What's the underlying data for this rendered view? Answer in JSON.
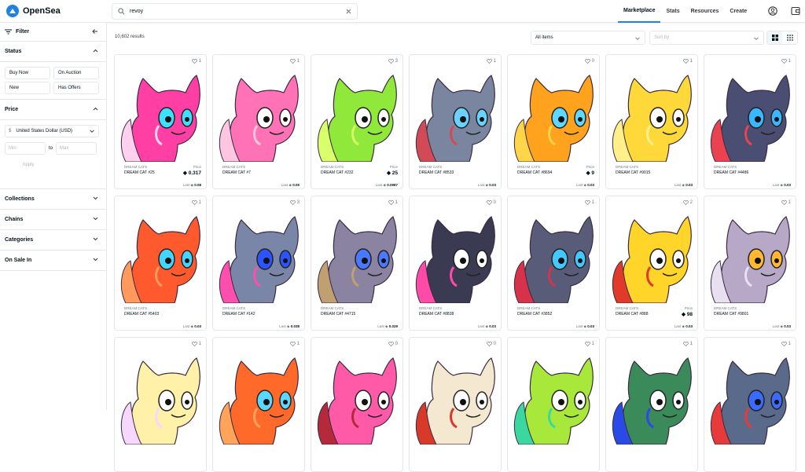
{
  "app": {
    "name": "OpenSea"
  },
  "search": {
    "value": "revoy"
  },
  "nav": {
    "items": [
      "Marketplace",
      "Stats",
      "Resources",
      "Create"
    ],
    "active": "Marketplace"
  },
  "sidebar": {
    "filter_label": "Filter",
    "status": {
      "label": "Status",
      "chips": [
        "Buy Now",
        "On Auction",
        "New",
        "Has Offers"
      ]
    },
    "price": {
      "label": "Price",
      "currency": "United States Dollar (USD)",
      "currency_symbol": "$",
      "min_placeholder": "Min",
      "to": "to",
      "max_placeholder": "Max",
      "apply": "Apply"
    },
    "sections": [
      "Collections",
      "Chains",
      "Categories",
      "On Sale In"
    ]
  },
  "main": {
    "results": "10,602 results",
    "filter_select": "All items",
    "sort_placeholder": "Sort by"
  },
  "colors": {
    "accent": "#2081e2",
    "border": "#e5e8eb"
  },
  "cards": [
    {
      "fav": "1",
      "collection": "DREAM CATS",
      "name": "DREAM CAT #25",
      "price_label": "Price",
      "price": "0.317",
      "last": "Last",
      "last_price": "0.08",
      "c1": "#ff3fa4",
      "c2": "#ffd1ee",
      "eye": "#3de0ff"
    },
    {
      "fav": "1",
      "collection": "DREAM CATS",
      "name": "DREAM CAT #7",
      "price_label": "",
      "price": "",
      "last": "Last",
      "last_price": "0.05",
      "c1": "#ff72b6",
      "c2": "#ffc6e2",
      "eye": "#ffffff"
    },
    {
      "fav": "3",
      "collection": "DREAM CATS",
      "name": "DREAM CAT #232",
      "price_label": "Price",
      "price": "25",
      "last": "Last",
      "last_price": "0.0987",
      "c1": "#8fe83a",
      "c2": "#d9ff6a",
      "eye": "#ffffff"
    },
    {
      "fav": "1",
      "collection": "DREAM CATS",
      "name": "DREAM CAT #8533",
      "price_label": "",
      "price": "",
      "last": "Last",
      "last_price": "0.03",
      "c1": "#7a86a0",
      "c2": "#d24a55",
      "eye": "#6ad2ff"
    },
    {
      "fav": "0",
      "collection": "DREAM CATS",
      "name": "DREAM CAT #8694",
      "price_label": "Price",
      "price": "9",
      "last": "Last",
      "last_price": "0.03",
      "c1": "#ffa21e",
      "c2": "#ffd64a",
      "eye": "#5fd8ff"
    },
    {
      "fav": "1",
      "collection": "DREAM CATS",
      "name": "DREAM CAT #9015",
      "price_label": "",
      "price": "",
      "last": "Last",
      "last_price": "0.03",
      "c1": "#ffd93a",
      "c2": "#fff08a",
      "eye": "#ffffff"
    },
    {
      "fav": "1",
      "collection": "DREAM CATS",
      "name": "DREAM CAT #4486",
      "price_label": "",
      "price": "",
      "last": "Last",
      "last_price": "0.03",
      "c1": "#4a4e72",
      "c2": "#e8434f",
      "eye": "#3ab8ff"
    },
    {
      "fav": "1",
      "collection": "DREAM CATS",
      "name": "DREAM CAT #5403",
      "price_label": "",
      "price": "",
      "last": "Last",
      "last_price": "0.03",
      "c1": "#ff5a2e",
      "c2": "#ff9a5c",
      "eye": "#42d5ff"
    },
    {
      "fav": "3",
      "collection": "DREAM CATS",
      "name": "DREAM CAT #142",
      "price_label": "",
      "price": "",
      "last": "Last",
      "last_price": "0.038",
      "c1": "#7a86a8",
      "c2": "#ff4fae",
      "eye": "#2b54ff"
    },
    {
      "fav": "1",
      "collection": "DREAM CATS",
      "name": "DREAM CAT #4715",
      "price_label": "",
      "price": "",
      "last": "Last",
      "last_price": "0.029",
      "c1": "#8a84a2",
      "c2": "#c0a070",
      "eye": "#4a78ff"
    },
    {
      "fav": "0",
      "collection": "DREAM CATS",
      "name": "DREAM CAT #8838",
      "price_label": "",
      "price": "",
      "last": "Last",
      "last_price": "0.03",
      "c1": "#3a3a52",
      "c2": "#ff4aa8",
      "eye": "#ffffff"
    },
    {
      "fav": "1",
      "collection": "DREAM CATS",
      "name": "DREAM CAT #3852",
      "price_label": "",
      "price": "",
      "last": "Last",
      "last_price": "0.03",
      "c1": "#595c78",
      "c2": "#d8314a",
      "eye": "#42c8ff"
    },
    {
      "fav": "2",
      "collection": "DREAM CATS",
      "name": "DREAM CAT #888",
      "price_label": "Price",
      "price": "98",
      "last": "Last",
      "last_price": "0.03",
      "c1": "#ffd52a",
      "c2": "#e23a2a",
      "eye": "#ffffff"
    },
    {
      "fav": "1",
      "collection": "DREAM CATS",
      "name": "DREAM CAT #9801",
      "price_label": "",
      "price": "",
      "last": "Last",
      "last_price": "0.03",
      "c1": "#b8a8c8",
      "c2": "#e8e0f0",
      "eye": "#ffb830"
    },
    {
      "fav": "1",
      "collection": "",
      "name": "",
      "price_label": "",
      "price": "",
      "last": "",
      "last_price": "",
      "c1": "#fff2a8",
      "c2": "#f5d7ff",
      "eye": "#ffffff"
    },
    {
      "fav": "1",
      "collection": "",
      "name": "",
      "price_label": "",
      "price": "",
      "last": "",
      "last_price": "",
      "c1": "#ff6a2a",
      "c2": "#ffa45a",
      "eye": "#5ad8ff"
    },
    {
      "fav": "0",
      "collection": "",
      "name": "",
      "price_label": "",
      "price": "",
      "last": "",
      "last_price": "",
      "c1": "#ff5aa8",
      "c2": "#b52a3a",
      "eye": "#ffffff"
    },
    {
      "fav": "0",
      "collection": "",
      "name": "",
      "price_label": "",
      "price": "",
      "last": "",
      "last_price": "",
      "c1": "#f5e8d0",
      "c2": "#d83a2a",
      "eye": "#ffffff"
    },
    {
      "fav": "1",
      "collection": "",
      "name": "",
      "price_label": "",
      "price": "",
      "last": "",
      "last_price": "",
      "c1": "#a8e83a",
      "c2": "#3ad8a0",
      "eye": "#ffffff"
    },
    {
      "fav": "1",
      "collection": "",
      "name": "",
      "price_label": "",
      "price": "",
      "last": "",
      "last_price": "",
      "c1": "#3a8a5a",
      "c2": "#2a4ae8",
      "eye": "#ffffff"
    },
    {
      "fav": "1",
      "collection": "",
      "name": "",
      "price_label": "",
      "price": "",
      "last": "",
      "last_price": "",
      "c1": "#5a6a8a",
      "c2": "#e83a3a",
      "eye": "#3a6aff"
    }
  ]
}
